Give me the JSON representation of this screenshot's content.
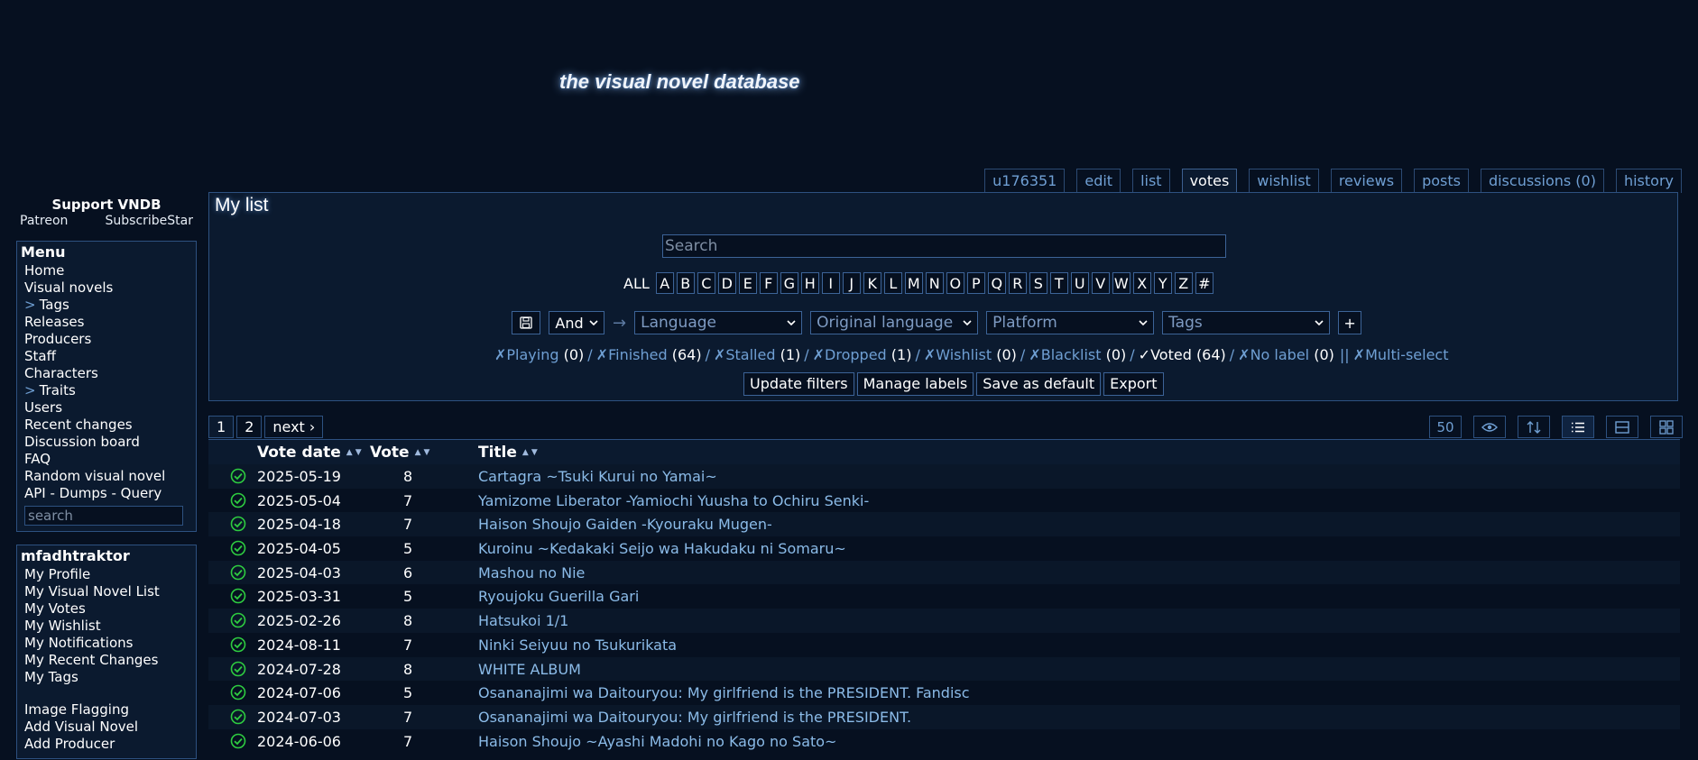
{
  "site": {
    "title": "the visual novel database"
  },
  "user_tabs": [
    "u176351",
    "edit",
    "list",
    "votes",
    "wishlist",
    "reviews",
    "posts",
    "discussions (0)",
    "history"
  ],
  "support": {
    "title": "Support VNDB",
    "patreon": "Patreon",
    "subscribestar": "SubscribeStar"
  },
  "menu": {
    "title": "Menu",
    "items": [
      {
        "label": "Home",
        "prefix": ""
      },
      {
        "label": "Visual novels",
        "prefix": ""
      },
      {
        "label": "Tags",
        "prefix": ">"
      },
      {
        "label": "Releases",
        "prefix": ""
      },
      {
        "label": "Producers",
        "prefix": ""
      },
      {
        "label": "Staff",
        "prefix": ""
      },
      {
        "label": "Characters",
        "prefix": ""
      },
      {
        "label": "Traits",
        "prefix": ">"
      },
      {
        "label": "Users",
        "prefix": ""
      },
      {
        "label": "Recent changes",
        "prefix": ""
      },
      {
        "label": "Discussion board",
        "prefix": ""
      },
      {
        "label": "FAQ",
        "prefix": ""
      },
      {
        "label": "Random visual novel",
        "prefix": ""
      },
      {
        "label": "API - Dumps - Query",
        "prefix": ""
      }
    ],
    "search_placeholder": "search"
  },
  "usermenu": {
    "title": "mfadhtraktor",
    "items": [
      "My Profile",
      "My Visual Novel List",
      "My Votes",
      "My Wishlist",
      "My Notifications",
      "My Recent Changes",
      "My Tags"
    ],
    "items2": [
      "Image Flagging",
      "Add Visual Novel",
      "Add Producer"
    ]
  },
  "main": {
    "title": "My list",
    "search_placeholder": "Search",
    "alpha_all": "ALL",
    "alpha": [
      "A",
      "B",
      "C",
      "D",
      "E",
      "F",
      "G",
      "H",
      "I",
      "J",
      "K",
      "L",
      "M",
      "N",
      "O",
      "P",
      "Q",
      "R",
      "S",
      "T",
      "U",
      "V",
      "W",
      "X",
      "Y",
      "Z",
      "#"
    ],
    "filters": {
      "and_label": "And",
      "arrow": "→",
      "selects": [
        "Language",
        "Original language",
        "Platform",
        "Tags"
      ],
      "add": "+"
    },
    "statuses": [
      {
        "label": "Playing",
        "count": "(0)",
        "mark": "✗",
        "on": false
      },
      {
        "label": "Finished",
        "count": "(64)",
        "mark": "✗",
        "on": false
      },
      {
        "label": "Stalled",
        "count": "(1)",
        "mark": "✗",
        "on": false
      },
      {
        "label": "Dropped",
        "count": "(1)",
        "mark": "✗",
        "on": false
      },
      {
        "label": "Wishlist",
        "count": "(0)",
        "mark": "✗",
        "on": false
      },
      {
        "label": "Blacklist",
        "count": "(0)",
        "mark": "✗",
        "on": false
      },
      {
        "label": "Voted",
        "count": "(64)",
        "mark": "✓",
        "on": true
      },
      {
        "label": "No label",
        "count": "(0)",
        "mark": "✗",
        "on": false
      }
    ],
    "multiselect": "Multi-select",
    "multiselect_sep": "||",
    "actions": [
      "Update filters",
      "Manage labels",
      "Save as default",
      "Export"
    ]
  },
  "pager": {
    "pages": [
      "1",
      "2"
    ],
    "next": "next ›",
    "per_page": "50"
  },
  "table": {
    "columns": [
      "Vote date",
      "Vote",
      "Title"
    ],
    "rows": [
      {
        "date": "2025-05-19",
        "vote": "8",
        "title": "Cartagra ~Tsuki Kurui no Yamai~"
      },
      {
        "date": "2025-05-04",
        "vote": "7",
        "title": "Yamizome Liberator -Yamiochi Yuusha to Ochiru Senki-"
      },
      {
        "date": "2025-04-18",
        "vote": "7",
        "title": "Haison Shoujo Gaiden -Kyouraku Mugen-"
      },
      {
        "date": "2025-04-05",
        "vote": "5",
        "title": "Kuroinu ~Kedakaki Seijo wa Hakudaku ni Somaru~"
      },
      {
        "date": "2025-04-03",
        "vote": "6",
        "title": "Mashou no Nie"
      },
      {
        "date": "2025-03-31",
        "vote": "5",
        "title": "Ryoujoku Guerilla Gari"
      },
      {
        "date": "2025-02-26",
        "vote": "8",
        "title": "Hatsukoi 1/1"
      },
      {
        "date": "2024-08-11",
        "vote": "7",
        "title": "Ninki Seiyuu no Tsukurikata"
      },
      {
        "date": "2024-07-28",
        "vote": "8",
        "title": "WHITE ALBUM"
      },
      {
        "date": "2024-07-06",
        "vote": "5",
        "title": "Osananajimi wa Daitouryou: My girlfriend is the PRESIDENT. Fandisc"
      },
      {
        "date": "2024-07-03",
        "vote": "7",
        "title": "Osananajimi wa Daitouryou: My girlfriend is the PRESIDENT."
      },
      {
        "date": "2024-06-06",
        "vote": "7",
        "title": "Haison Shoujo ~Ayashi Madohi no Kago no Sato~"
      }
    ]
  },
  "colors": {
    "background": "#061020",
    "panel": "#0b1a2f",
    "border": "#2d5180",
    "link": "#8bbbe8",
    "check": "#2ecc40"
  }
}
